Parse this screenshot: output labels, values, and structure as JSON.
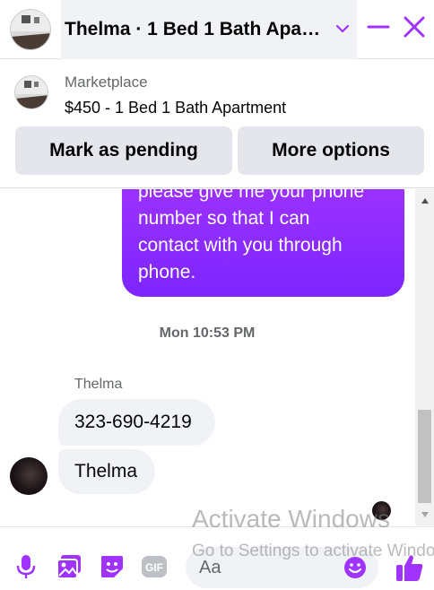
{
  "header": {
    "title": "Thelma · 1 Bed 1 Bath Apar…",
    "colors": {
      "accent": "#a033ff",
      "title_bg": "#f0f2f5"
    }
  },
  "marketplace": {
    "label": "Marketplace",
    "listing": "$450 - 1 Bed 1 Bath Apartment",
    "pending_label": "Mark as pending",
    "more_label": "More options"
  },
  "chat": {
    "outgoing_lines": [
      "please give me your phone",
      "number so that I can",
      "contact with you through",
      "phone."
    ],
    "timestamp": "Mon 10:53 PM",
    "sender_name": "Thelma",
    "incoming": [
      "323-690-4219",
      "Thelma"
    ]
  },
  "composer": {
    "placeholder": "Aa",
    "icons": [
      "mic-icon",
      "photo-icon",
      "sticker-icon",
      "gif-icon",
      "emoji-icon",
      "thumbs-up-icon"
    ],
    "gif_text": "GIF"
  },
  "watermark": {
    "line1": "Activate Windows",
    "line2": "Go to Settings to activate Windows."
  }
}
